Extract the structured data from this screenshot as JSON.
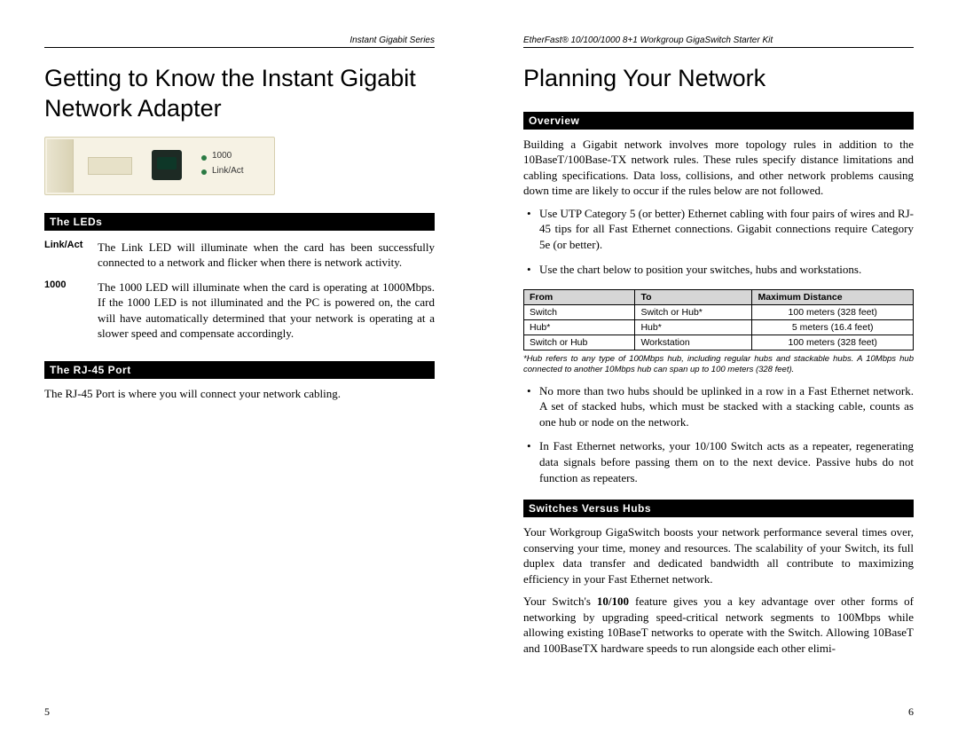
{
  "left": {
    "running_header": "Instant Gigabit Series",
    "title": "Getting to Know the Instant Gigabit Network Adapter",
    "device_labels": {
      "l1000": "1000",
      "llink": "Link/Act"
    },
    "section_leds": "The LEDs",
    "leds": {
      "linkact_term": "Link/Act",
      "linkact_body": "The Link LED will illuminate when the card has been successfully connected to a network and flicker when there is network activity.",
      "g1000_term": "1000",
      "g1000_body": "The 1000 LED will illuminate when the card is operating at 1000Mbps. If the 1000 LED is not illuminated and the PC is powered on, the card will have automatically determined that your network is operating at a slower speed and compensate accordingly."
    },
    "section_rj45": "The RJ-45 Port",
    "rj45_body": "The RJ-45 Port is where you will connect your network cabling.",
    "page_number": "5"
  },
  "right": {
    "running_header": "EtherFast® 10/100/1000 8+1 Workgroup GigaSwitch Starter Kit",
    "title": "Planning Your Network",
    "section_overview": "Overview",
    "overview_body": "Building a Gigabit network involves more topology rules in addition to the 10BaseT/100Base-TX network rules. These rules specify distance limitations and cabling specifications. Data loss, collisions, and other network problems causing down time are likely to occur if the rules below are not followed.",
    "bullets1": {
      "b1": "Use UTP Category 5 (or better) Ethernet cabling with four pairs of wires and RJ-45 tips for all Fast Ethernet connections. Gigabit connections require Category 5e (or better).",
      "b2": "Use the chart below to position your switches, hubs and workstations."
    },
    "table": {
      "headers": {
        "from": "From",
        "to": "To",
        "max": "Maximum Distance"
      },
      "rows": [
        {
          "from": "Switch",
          "to": "Switch or Hub*",
          "max": "100 meters (328 feet)"
        },
        {
          "from": "Hub*",
          "to": "Hub*",
          "max": "5 meters (16.4 feet)"
        },
        {
          "from": "Switch or Hub",
          "to": "Workstation",
          "max": "100 meters (328 feet)"
        }
      ]
    },
    "table_note": "*Hub refers to any type of 100Mbps hub, including regular hubs and stackable hubs. A 10Mbps hub connected to another 10Mbps hub can span up to 100 meters (328 feet).",
    "bullets2": {
      "b1": "No more than two hubs should be uplinked in a row in a Fast Ethernet network. A set of stacked hubs, which must be stacked with a stacking cable, counts as one hub or node on the network.",
      "b2": "In Fast Ethernet networks, your 10/100 Switch acts as a repeater, regenerating data signals before passing them on to the next device. Passive hubs do not function as repeaters."
    },
    "section_switches": "Switches Versus Hubs",
    "switches_p1": "Your Workgroup GigaSwitch boosts your network performance several times over, conserving your time, money and resources. The scalability of your Switch, its full duplex data transfer and dedicated bandwidth all contribute to maximizing efficiency in your Fast Ethernet network.",
    "switches_p2_a": "Your Switch's ",
    "switches_p2_bold": "10/100",
    "switches_p2_b": " feature gives you a key advantage over other forms of networking by upgrading speed-critical network segments to 100Mbps while allowing existing 10BaseT networks to operate with the Switch. Allowing 10BaseT and 100BaseTX hardware speeds to run alongside each other elimi-",
    "page_number": "6"
  }
}
